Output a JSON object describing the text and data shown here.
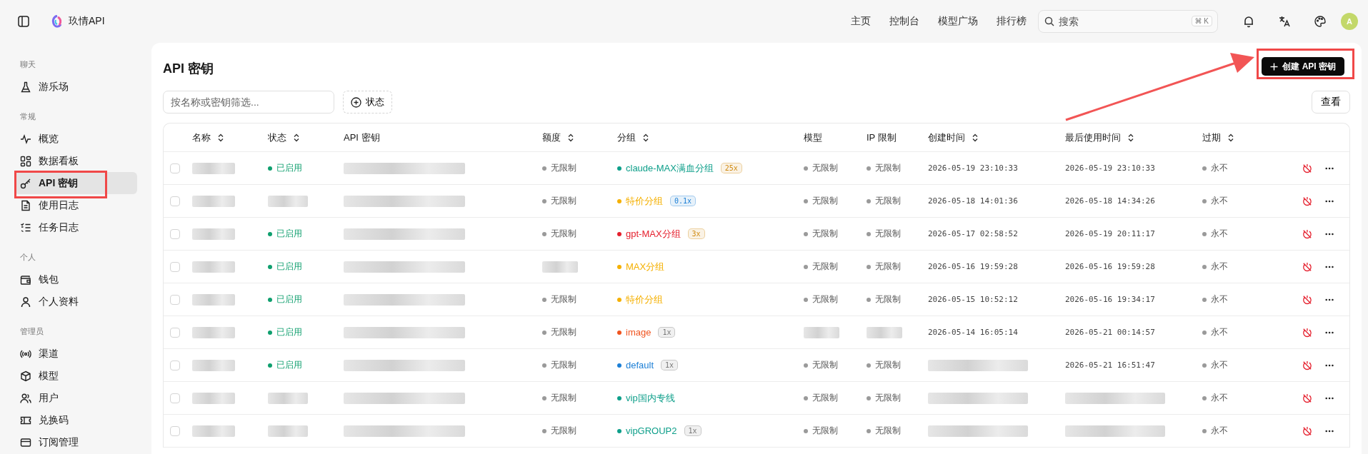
{
  "topbar": {
    "brand": "玖情API",
    "nav": [
      {
        "label": "主页"
      },
      {
        "label": "控制台"
      },
      {
        "label": "模型广场"
      },
      {
        "label": "排行榜"
      }
    ],
    "search": {
      "placeholder": "搜索",
      "shortcut": [
        "⌘",
        "K"
      ]
    },
    "avatar": "A"
  },
  "sidebar": {
    "sections": [
      {
        "title": "聊天",
        "items": [
          {
            "label": "游乐场",
            "selected": false
          }
        ]
      },
      {
        "title": "常规",
        "items": [
          {
            "label": "概览",
            "selected": false
          },
          {
            "label": "数据看板",
            "selected": false
          },
          {
            "label": "API 密钥",
            "selected": true
          },
          {
            "label": "使用日志",
            "selected": false
          },
          {
            "label": "任务日志",
            "selected": false
          }
        ]
      },
      {
        "title": "个人",
        "items": [
          {
            "label": "钱包",
            "selected": false
          },
          {
            "label": "个人资料",
            "selected": false
          }
        ]
      },
      {
        "title": "管理员",
        "items": [
          {
            "label": "渠道",
            "selected": false
          },
          {
            "label": "模型",
            "selected": false
          },
          {
            "label": "用户",
            "selected": false
          },
          {
            "label": "兑换码",
            "selected": false
          },
          {
            "label": "订阅管理",
            "selected": false
          }
        ]
      }
    ]
  },
  "page": {
    "title": "API 密钥",
    "create_button": "创建 API 密钥",
    "filter": {
      "placeholder": "按名称或密钥筛选..."
    },
    "status_filter": "状态",
    "view_button": "查看"
  },
  "table": {
    "columns": [
      {
        "label": "名称",
        "sortable": true
      },
      {
        "label": "状态",
        "sortable": true
      },
      {
        "label": "API 密钥",
        "sortable": false
      },
      {
        "label": "额度",
        "sortable": true
      },
      {
        "label": "分组",
        "sortable": true
      },
      {
        "label": "模型",
        "sortable": false
      },
      {
        "label": "IP 限制",
        "sortable": false
      },
      {
        "label": "创建时间",
        "sortable": true
      },
      {
        "label": "最后使用时间",
        "sortable": true
      },
      {
        "label": "过期",
        "sortable": true
      }
    ],
    "rows": [
      {
        "selected": false,
        "status": "已启用",
        "quota": "无限制",
        "group": {
          "name": "claude-MAX满血分组",
          "color": "#0e9f8a"
        },
        "multiplier": {
          "text": "25x",
          "color": "#d08a10"
        },
        "model": "无限制",
        "ip_limit": "无限制",
        "created": "2026-05-19 23:10:33",
        "last_used": "2026-05-19 23:10:33",
        "expires": "永不"
      },
      {
        "selected": false,
        "quota": "无限制",
        "group": {
          "name": "特价分组",
          "color": "#f5b000"
        },
        "multiplier": {
          "text": "0.1x",
          "color": "#1c7fd6"
        },
        "model": "无限制",
        "ip_limit": "无限制",
        "created": "2026-05-18 14:01:36",
        "last_used": "2026-05-18 14:34:26",
        "expires": "永不"
      },
      {
        "selected": false,
        "status": "已启用",
        "quota": "无限制",
        "group": {
          "name": "gpt-MAX分组",
          "color": "#e5202e"
        },
        "multiplier": {
          "text": "3x",
          "color": "#d08a10"
        },
        "model": "无限制",
        "ip_limit": "无限制",
        "created": "2026-05-17 02:58:52",
        "last_used": "2026-05-19 20:11:17",
        "expires": "永不"
      },
      {
        "selected": false,
        "status": "已启用",
        "group": {
          "name": "MAX分组",
          "color": "#f5b000"
        },
        "model": "无限制",
        "ip_limit": "无限制",
        "created": "2026-05-16 19:59:28",
        "last_used": "2026-05-16 19:59:28",
        "expires": "永不"
      },
      {
        "selected": false,
        "status": "已启用",
        "quota": "无限制",
        "group": {
          "name": "特价分组",
          "color": "#f5b000"
        },
        "model": "无限制",
        "ip_limit": "无限制",
        "created": "2026-05-15 10:52:12",
        "last_used": "2026-05-16 19:34:17",
        "expires": "永不"
      },
      {
        "selected": false,
        "status": "已启用",
        "quota": "无限制",
        "group": {
          "name": "image",
          "color": "#f0541f"
        },
        "multiplier": {
          "text": "1x",
          "color": "#777777"
        },
        "created": "2026-05-14 16:05:14",
        "last_used": "2026-05-21 00:14:57",
        "expires": "永不"
      },
      {
        "selected": false,
        "status": "已启用",
        "quota": "无限制",
        "group": {
          "name": "default",
          "color": "#1c7fd6"
        },
        "multiplier": {
          "text": "1x",
          "color": "#777777"
        },
        "model": "无限制",
        "ip_limit": "无限制",
        "last_used": "2026-05-21 16:51:47",
        "expires": "永不"
      },
      {
        "selected": false,
        "quota": "无限制",
        "group": {
          "name": "vip国内专线",
          "color": "#0e9f8a"
        },
        "model": "无限制",
        "ip_limit": "无限制",
        "expires": "永不"
      },
      {
        "selected": false,
        "quota": "无限制",
        "group": {
          "name": "vipGROUP2",
          "color": "#0e9f8a"
        },
        "multiplier": {
          "text": "1x",
          "color": "#777777"
        },
        "model": "无限制",
        "ip_limit": "无限制",
        "expires": "永不"
      }
    ]
  }
}
